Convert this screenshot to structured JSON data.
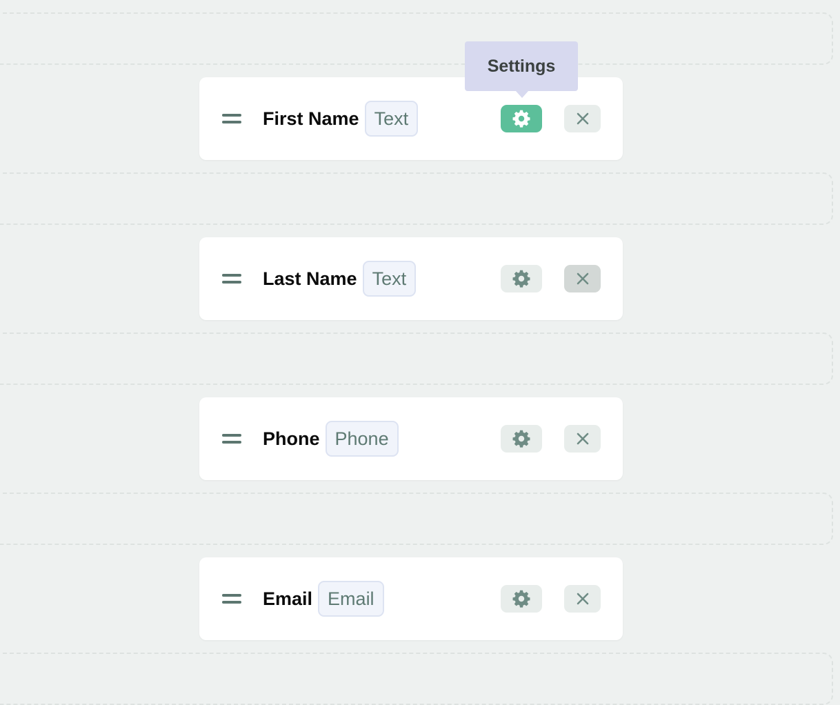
{
  "tooltip": {
    "text": "Settings"
  },
  "fields": [
    {
      "label": "First Name",
      "type": "Text",
      "settings_active": true,
      "remove_hovered": false
    },
    {
      "label": "Last Name",
      "type": "Text",
      "settings_active": false,
      "remove_hovered": true
    },
    {
      "label": "Phone",
      "type": "Phone",
      "settings_active": false,
      "remove_hovered": false
    },
    {
      "label": "Email",
      "type": "Email",
      "settings_active": false,
      "remove_hovered": false
    }
  ],
  "icons": {
    "drag": "drag-handle-icon",
    "settings": "gear-icon",
    "remove": "close-icon"
  },
  "colors": {
    "accent": "#5cbf9a",
    "icon": "#6f8c85",
    "label": "#0b0b0b",
    "badge_text": "#5e7a73",
    "tooltip_bg": "#d7d9ef",
    "background": "#eef1f0"
  }
}
